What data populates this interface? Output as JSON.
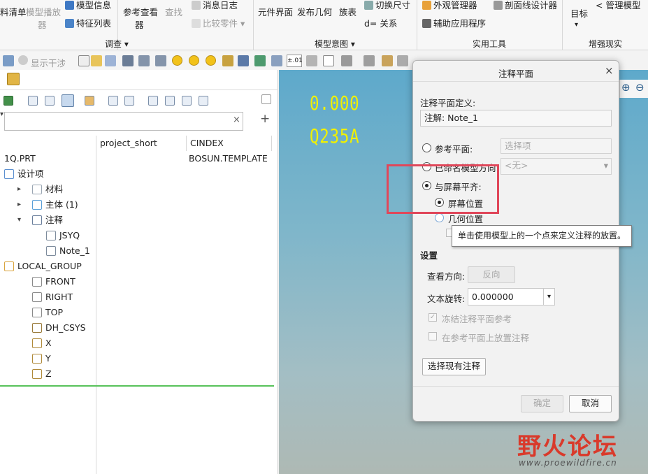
{
  "ribbon": {
    "items": [
      {
        "label": "料清单",
        "disabled": false
      },
      {
        "label": "模型播放",
        "disabled": true
      },
      {
        "label": "器",
        "disabled": true
      },
      {
        "label": "模型信息",
        "disabled": false
      },
      {
        "label": "特征列表",
        "disabled": false
      },
      {
        "label": "参考查看",
        "disabled": false
      },
      {
        "label": "器",
        "disabled": false
      },
      {
        "label": "查找",
        "disabled": true
      },
      {
        "label": "消息日志",
        "disabled": false
      },
      {
        "label": "比较零件",
        "disabled": true
      },
      {
        "label": "元件界面",
        "disabled": false
      },
      {
        "label": "发布几何",
        "disabled": false
      },
      {
        "label": "族表",
        "disabled": false
      },
      {
        "label": "切换尺寸",
        "disabled": false
      },
      {
        "label": "关系",
        "disabled": false
      },
      {
        "label": "外观管理器",
        "disabled": false
      },
      {
        "label": "剖面线设计器",
        "disabled": false
      },
      {
        "label": "辅助应用程序",
        "disabled": false
      },
      {
        "label": "目标",
        "disabled": false
      },
      {
        "label": "管理模型",
        "disabled": false
      }
    ],
    "relations_prefix": "d=",
    "groups": [
      "调查 ▾",
      "模型意图 ▾",
      "实用工具",
      "增强现实"
    ]
  },
  "toolbar": {
    "show_interference": "显示干涉",
    "tolerance_label": "±.01"
  },
  "panel": {
    "filter_placeholder": "",
    "columns": [
      "project_short",
      "CINDEX"
    ],
    "rows": [
      {
        "label": "1Q.PRT",
        "cindex": "BOSUN.TEMPLATE",
        "icon": "none",
        "expander": "",
        "level": 0
      },
      {
        "label": "设计项",
        "cindex": "",
        "icon": "design-items-icon",
        "expander": "",
        "level": 0
      },
      {
        "label": "材料",
        "cindex": "",
        "icon": "material-icon",
        "expander": "▸",
        "level": 1
      },
      {
        "label": "主体 (1)",
        "cindex": "",
        "icon": "body-icon",
        "expander": "▸",
        "level": 1
      },
      {
        "label": "注释",
        "cindex": "",
        "icon": "annotation-icon",
        "expander": "▾",
        "level": 1
      },
      {
        "label": "JSYQ",
        "cindex": "",
        "icon": "note-icon",
        "expander": "",
        "level": 2
      },
      {
        "label": "Note_1",
        "cindex": "",
        "icon": "note-icon",
        "expander": "",
        "level": 2
      },
      {
        "label": "LOCAL_GROUP",
        "cindex": "",
        "icon": "group-icon",
        "expander": "",
        "level": 0
      },
      {
        "label": "FRONT",
        "cindex": "",
        "icon": "datum-plane-icon",
        "expander": "",
        "level": 1
      },
      {
        "label": "RIGHT",
        "cindex": "",
        "icon": "datum-plane-icon",
        "expander": "",
        "level": 1
      },
      {
        "label": "TOP",
        "cindex": "",
        "icon": "datum-plane-icon",
        "expander": "",
        "level": 1
      },
      {
        "label": "DH_CSYS",
        "cindex": "",
        "icon": "csys-icon",
        "expander": "",
        "level": 1
      },
      {
        "label": "X",
        "cindex": "",
        "icon": "axis-icon",
        "expander": "",
        "level": 1
      },
      {
        "label": "Y",
        "cindex": "",
        "icon": "axis-icon",
        "expander": "",
        "level": 1
      },
      {
        "label": "Z",
        "cindex": "",
        "icon": "axis-icon",
        "expander": "",
        "level": 1
      }
    ]
  },
  "viewport": {
    "line1": "0.000",
    "line2": "Q235A"
  },
  "dialog": {
    "title": "注释平面",
    "close": "×",
    "definition_label": "注释平面定义:",
    "definition_value": "注解: Note_1",
    "opt_reference": "参考平面:",
    "reference_placeholder": "选择项",
    "opt_named": "已命名模型方向:",
    "named_value": "<无>",
    "opt_screen": "与屏幕平齐:",
    "sub_screen": "屏幕位置",
    "sub_geom": "几何位置",
    "settings": "设置",
    "view_dir": "查看方向:",
    "flip": "反向",
    "text_rotation": "文本旋转:",
    "rotation_value": "0.000000",
    "freeze": "冻结注释平面参考",
    "place_on_ref": "在参考平面上放置注释",
    "select_existing": "选择现有注释",
    "ok": "确定",
    "cancel": "取消"
  },
  "tooltip": "单击使用模型上的一个点来定义注释的放置。",
  "watermark": {
    "title": "野火论坛",
    "url": "www.proewildfire.cn"
  }
}
